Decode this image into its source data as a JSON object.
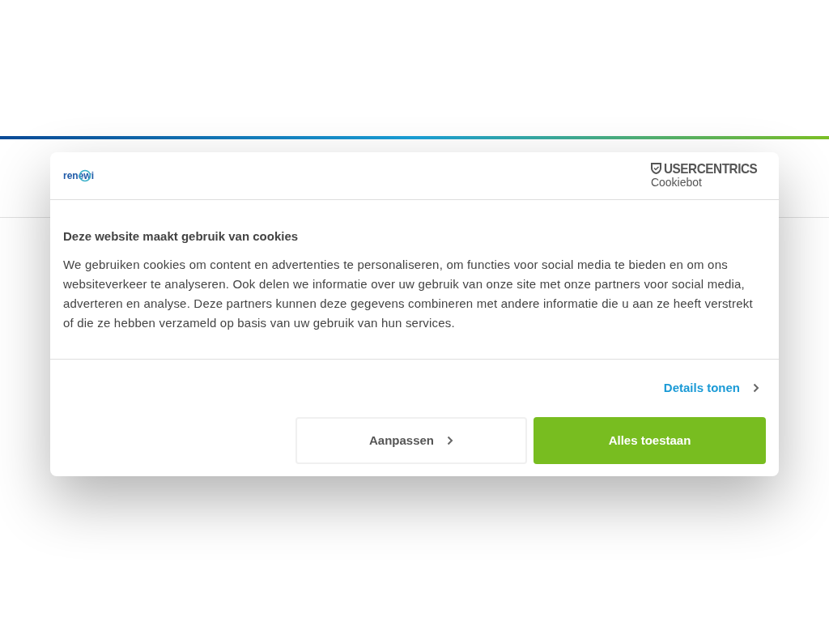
{
  "header": {
    "brand_logo": "renewi",
    "provider_logo": {
      "name": "USERCENTRICS",
      "product": "Cookiebot"
    }
  },
  "title": "Deze website maakt gebruik van cookies",
  "body": "We gebruiken cookies om content en advertenties te personaliseren, om functies voor social media te bieden en om ons websiteverkeer te analyseren. Ook delen we informatie over uw gebruik van onze site met onze partners voor social media, adverteren en analyse. Deze partners kunnen deze gegevens combineren met andere informatie die u aan ze heeft verstrekt of die ze hebben verzameld op basis van uw gebruik van hun services.",
  "details_link": "Details tonen",
  "buttons": [
    {
      "label": "Aanpassen",
      "kind": "secondary"
    },
    {
      "label": "Alles toestaan",
      "kind": "primary"
    }
  ]
}
